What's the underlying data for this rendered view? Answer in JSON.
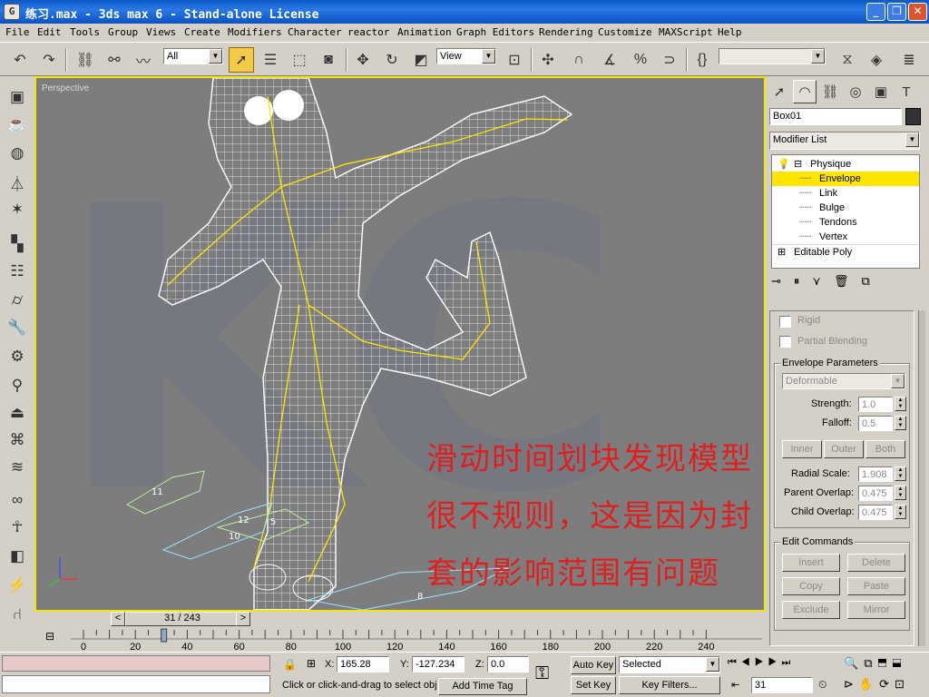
{
  "window": {
    "title": "练习.max - 3ds max 6 - Stand-alone License",
    "icon": "3ds-max-icon",
    "controls": {
      "minimize": "_",
      "maximize": "❐",
      "close": "✕"
    }
  },
  "menu": [
    "File",
    "Edit",
    "Tools",
    "Group",
    "Views",
    "Create",
    "Modifiers",
    "Character",
    "reactor",
    "Animation",
    "Graph Editors",
    "Rendering",
    "Customize",
    "MAXScript",
    "Help"
  ],
  "toolbar": {
    "selection_filter": "All",
    "reference_coord": "View",
    "named_selection": ""
  },
  "viewport": {
    "label": "Perspective",
    "annotation_lines": [
      "滑动时间划块发现模型",
      "很不规则，这是因为封",
      "套的影响范围有问题"
    ],
    "link_labels": [
      "11",
      "12",
      "10",
      "5",
      "8"
    ],
    "watermark": "KC"
  },
  "timeslider": {
    "frame_display": "31 / 243",
    "prev_arrow": "<",
    "next_arrow": ">"
  },
  "trackbar": {
    "ticks": [
      "0",
      "20",
      "40",
      "60",
      "80",
      "100",
      "120",
      "140",
      "160",
      "180",
      "200",
      "220",
      "240"
    ]
  },
  "status": {
    "x_label": "X:",
    "x_value": "165.28",
    "y_label": "Y:",
    "y_value": "-127.234",
    "z_label": "Z:",
    "z_value": "0.0",
    "prompt": "Click or click-and-drag to select obj",
    "add_time_tag": "Add Time Tag",
    "auto_key": "Auto Key",
    "set_key": "Set Key",
    "key_mode": "Selected",
    "key_filters": "Key Filters...",
    "current_frame": "31"
  },
  "command_panel": {
    "object_name": "Box01",
    "object_color": "#333333",
    "modifier_list": "Modifier List",
    "stack": [
      {
        "label": "Physique",
        "level": 0,
        "selected": false
      },
      {
        "label": "Envelope",
        "level": 1,
        "selected": true
      },
      {
        "label": "Link",
        "level": 1,
        "selected": false
      },
      {
        "label": "Bulge",
        "level": 1,
        "selected": false
      },
      {
        "label": "Tendons",
        "level": 1,
        "selected": false
      },
      {
        "label": "Vertex",
        "level": 1,
        "selected": false
      },
      {
        "label": "Editable Poly",
        "level": 0,
        "selected": false
      }
    ],
    "rigid_label": "Rigid",
    "partial_blending_label": "Partial Blending",
    "envelope_params": {
      "title": "Envelope Parameters",
      "type_value": "Deformable",
      "strength_label": "Strength:",
      "strength_value": "1.0",
      "falloff_label": "Falloff:",
      "falloff_value": "0.5",
      "inner": "Inner",
      "outer": "Outer",
      "both": "Both",
      "radial_scale_label": "Radial Scale:",
      "radial_scale_value": "1.908",
      "parent_overlap_label": "Parent Overlap:",
      "parent_overlap_value": "0.475",
      "child_overlap_label": "Child Overlap:",
      "child_overlap_value": "0.475"
    },
    "edit_commands": {
      "title": "Edit Commands",
      "insert": "Insert",
      "delete": "Delete",
      "copy": "Copy",
      "paste": "Paste",
      "exclude": "Exclude",
      "mirror": "Mirror"
    }
  },
  "colors": {
    "active_viewport_border": "#f4e50a",
    "selection_highlight": "#ffe600",
    "annotation_text": "#e02020",
    "titlebar": "#0a58c8"
  }
}
